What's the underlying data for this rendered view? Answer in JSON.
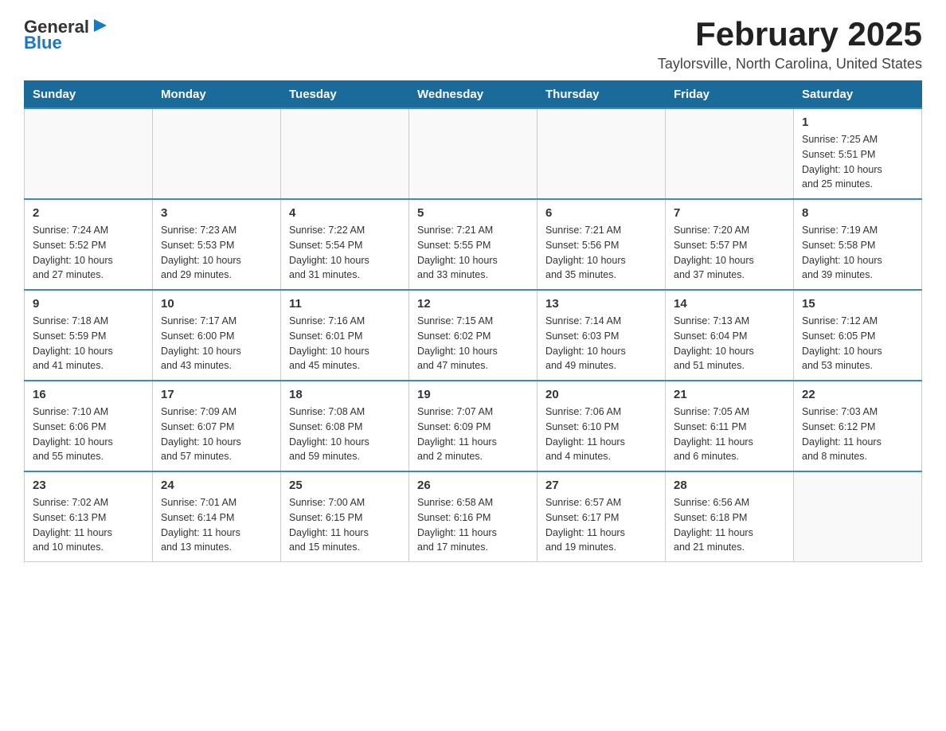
{
  "logo": {
    "text_general": "General",
    "text_blue": "Blue",
    "arrow": "▶"
  },
  "title": {
    "month": "February 2025",
    "location": "Taylorsville, North Carolina, United States"
  },
  "headers": [
    "Sunday",
    "Monday",
    "Tuesday",
    "Wednesday",
    "Thursday",
    "Friday",
    "Saturday"
  ],
  "weeks": [
    [
      {
        "day": "",
        "info": ""
      },
      {
        "day": "",
        "info": ""
      },
      {
        "day": "",
        "info": ""
      },
      {
        "day": "",
        "info": ""
      },
      {
        "day": "",
        "info": ""
      },
      {
        "day": "",
        "info": ""
      },
      {
        "day": "1",
        "info": "Sunrise: 7:25 AM\nSunset: 5:51 PM\nDaylight: 10 hours\nand 25 minutes."
      }
    ],
    [
      {
        "day": "2",
        "info": "Sunrise: 7:24 AM\nSunset: 5:52 PM\nDaylight: 10 hours\nand 27 minutes."
      },
      {
        "day": "3",
        "info": "Sunrise: 7:23 AM\nSunset: 5:53 PM\nDaylight: 10 hours\nand 29 minutes."
      },
      {
        "day": "4",
        "info": "Sunrise: 7:22 AM\nSunset: 5:54 PM\nDaylight: 10 hours\nand 31 minutes."
      },
      {
        "day": "5",
        "info": "Sunrise: 7:21 AM\nSunset: 5:55 PM\nDaylight: 10 hours\nand 33 minutes."
      },
      {
        "day": "6",
        "info": "Sunrise: 7:21 AM\nSunset: 5:56 PM\nDaylight: 10 hours\nand 35 minutes."
      },
      {
        "day": "7",
        "info": "Sunrise: 7:20 AM\nSunset: 5:57 PM\nDaylight: 10 hours\nand 37 minutes."
      },
      {
        "day": "8",
        "info": "Sunrise: 7:19 AM\nSunset: 5:58 PM\nDaylight: 10 hours\nand 39 minutes."
      }
    ],
    [
      {
        "day": "9",
        "info": "Sunrise: 7:18 AM\nSunset: 5:59 PM\nDaylight: 10 hours\nand 41 minutes."
      },
      {
        "day": "10",
        "info": "Sunrise: 7:17 AM\nSunset: 6:00 PM\nDaylight: 10 hours\nand 43 minutes."
      },
      {
        "day": "11",
        "info": "Sunrise: 7:16 AM\nSunset: 6:01 PM\nDaylight: 10 hours\nand 45 minutes."
      },
      {
        "day": "12",
        "info": "Sunrise: 7:15 AM\nSunset: 6:02 PM\nDaylight: 10 hours\nand 47 minutes."
      },
      {
        "day": "13",
        "info": "Sunrise: 7:14 AM\nSunset: 6:03 PM\nDaylight: 10 hours\nand 49 minutes."
      },
      {
        "day": "14",
        "info": "Sunrise: 7:13 AM\nSunset: 6:04 PM\nDaylight: 10 hours\nand 51 minutes."
      },
      {
        "day": "15",
        "info": "Sunrise: 7:12 AM\nSunset: 6:05 PM\nDaylight: 10 hours\nand 53 minutes."
      }
    ],
    [
      {
        "day": "16",
        "info": "Sunrise: 7:10 AM\nSunset: 6:06 PM\nDaylight: 10 hours\nand 55 minutes."
      },
      {
        "day": "17",
        "info": "Sunrise: 7:09 AM\nSunset: 6:07 PM\nDaylight: 10 hours\nand 57 minutes."
      },
      {
        "day": "18",
        "info": "Sunrise: 7:08 AM\nSunset: 6:08 PM\nDaylight: 10 hours\nand 59 minutes."
      },
      {
        "day": "19",
        "info": "Sunrise: 7:07 AM\nSunset: 6:09 PM\nDaylight: 11 hours\nand 2 minutes."
      },
      {
        "day": "20",
        "info": "Sunrise: 7:06 AM\nSunset: 6:10 PM\nDaylight: 11 hours\nand 4 minutes."
      },
      {
        "day": "21",
        "info": "Sunrise: 7:05 AM\nSunset: 6:11 PM\nDaylight: 11 hours\nand 6 minutes."
      },
      {
        "day": "22",
        "info": "Sunrise: 7:03 AM\nSunset: 6:12 PM\nDaylight: 11 hours\nand 8 minutes."
      }
    ],
    [
      {
        "day": "23",
        "info": "Sunrise: 7:02 AM\nSunset: 6:13 PM\nDaylight: 11 hours\nand 10 minutes."
      },
      {
        "day": "24",
        "info": "Sunrise: 7:01 AM\nSunset: 6:14 PM\nDaylight: 11 hours\nand 13 minutes."
      },
      {
        "day": "25",
        "info": "Sunrise: 7:00 AM\nSunset: 6:15 PM\nDaylight: 11 hours\nand 15 minutes."
      },
      {
        "day": "26",
        "info": "Sunrise: 6:58 AM\nSunset: 6:16 PM\nDaylight: 11 hours\nand 17 minutes."
      },
      {
        "day": "27",
        "info": "Sunrise: 6:57 AM\nSunset: 6:17 PM\nDaylight: 11 hours\nand 19 minutes."
      },
      {
        "day": "28",
        "info": "Sunrise: 6:56 AM\nSunset: 6:18 PM\nDaylight: 11 hours\nand 21 minutes."
      },
      {
        "day": "",
        "info": ""
      }
    ]
  ]
}
